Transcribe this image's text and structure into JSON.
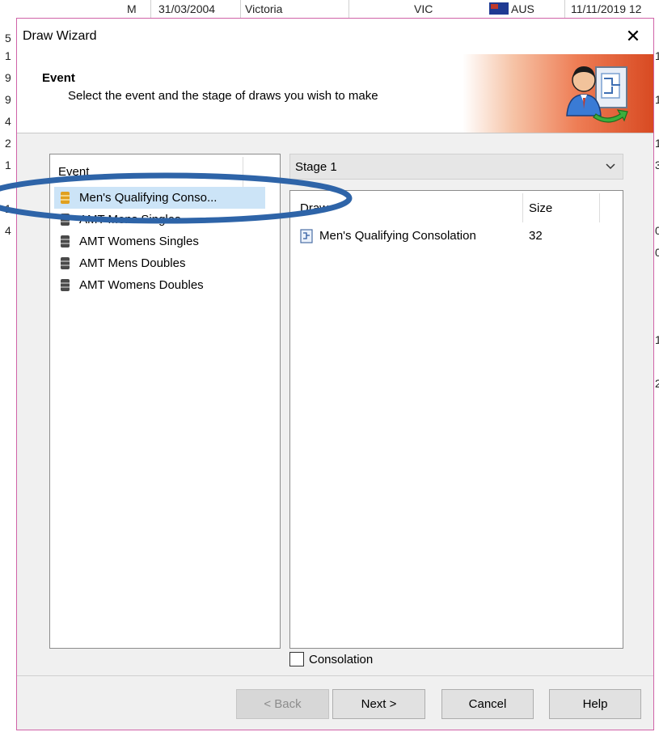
{
  "background": {
    "row": [
      "M",
      "31/03/2004",
      "Victoria",
      "VIC",
      "AUS",
      "11/11/2019 12"
    ],
    "left_digits": [
      "5",
      "1",
      "9",
      "9",
      "4",
      "2",
      "1",
      "1",
      "4"
    ],
    "right_digits": [
      "1",
      "1",
      "1",
      "3",
      "0",
      "0",
      "1",
      "2"
    ]
  },
  "dialog": {
    "title": "Draw Wizard",
    "close_glyph": "✕",
    "header": {
      "title": "Event",
      "subtitle": "Select the event and the stage of draws you wish to make"
    },
    "event_panel": {
      "column_header": "Event",
      "items": [
        {
          "label": "Men's Qualifying Conso...",
          "selected": true
        },
        {
          "label": "AMT Mens Singles",
          "selected": false
        },
        {
          "label": "AMT Womens Singles",
          "selected": false
        },
        {
          "label": "AMT Mens Doubles",
          "selected": false
        },
        {
          "label": "AMT Womens Doubles",
          "selected": false
        }
      ]
    },
    "stage_select": {
      "value": "Stage 1"
    },
    "draw_table": {
      "columns": [
        "Draw",
        "Size"
      ],
      "rows": [
        {
          "name": "Men's Qualifying Consolation",
          "size": "32"
        }
      ]
    },
    "consolation": {
      "label": "Consolation",
      "checked": false
    },
    "buttons": {
      "back": "< Back",
      "next": "Next >",
      "cancel": "Cancel",
      "help": "Help"
    }
  },
  "colors": {
    "selection": "#cce4f7",
    "dialog_border": "#d063a8",
    "annotation": "#2e64a8",
    "header_accent": "#d84a22"
  }
}
